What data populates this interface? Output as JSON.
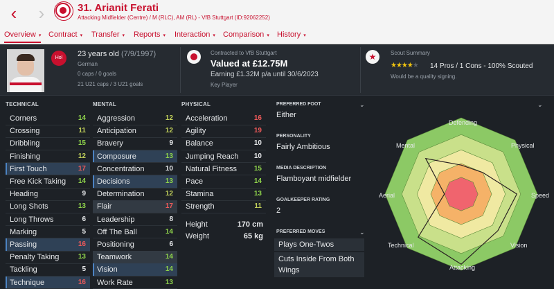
{
  "header": {
    "back_icon": "chevron-left-icon",
    "forward_icon": "chevron-right-icon",
    "player_name": "31. Arianit Ferati",
    "player_subtitle": "Attacking Midfielder (Centre) / M (RLC), AM (RL) - VfB Stuttgart (ID:92062252)"
  },
  "tabs": [
    {
      "label": "Overview",
      "active": true
    },
    {
      "label": "Contract"
    },
    {
      "label": "Transfer"
    },
    {
      "label": "Reports"
    },
    {
      "label": "Interaction"
    },
    {
      "label": "Comparison"
    },
    {
      "label": "History"
    }
  ],
  "overview": {
    "age": "23 years old",
    "dob": "(7/9/1997)",
    "nationality": "German",
    "flag_text": "Hol",
    "caps": "0 caps / 0 goals",
    "u21_caps": "21 U21 caps / 3 U21 goals",
    "contracted_to": "Contracted to VfB Stuttgart",
    "valued": "Valued at £12.75M",
    "earning": "Earning £1.32M p/a until 30/6/2023",
    "squad_status": "Key Player",
    "scout_title": "Scout Summary",
    "scout_stars": 4,
    "scout_pros": "14 Pros / 1 Cons - 100% Scouted",
    "scout_quote": "Would be a quality signing."
  },
  "attributes": {
    "technical_title": "TECHNICAL",
    "mental_title": "MENTAL",
    "physical_title": "PHYSICAL",
    "technical": [
      {
        "name": "Corners",
        "value": "14"
      },
      {
        "name": "Crossing",
        "value": "11"
      },
      {
        "name": "Dribbling",
        "value": "15"
      },
      {
        "name": "Finishing",
        "value": "12"
      },
      {
        "name": "First Touch",
        "value": "17"
      },
      {
        "name": "Free Kick Taking",
        "value": "14"
      },
      {
        "name": "Heading",
        "value": "9"
      },
      {
        "name": "Long Shots",
        "value": "13"
      },
      {
        "name": "Long Throws",
        "value": "6"
      },
      {
        "name": "Marking",
        "value": "5"
      },
      {
        "name": "Passing",
        "value": "16"
      },
      {
        "name": "Penalty Taking",
        "value": "13"
      },
      {
        "name": "Tackling",
        "value": "5"
      },
      {
        "name": "Technique",
        "value": "16"
      }
    ],
    "mental": [
      {
        "name": "Aggression",
        "value": "12"
      },
      {
        "name": "Anticipation",
        "value": "12"
      },
      {
        "name": "Bravery",
        "value": "9"
      },
      {
        "name": "Composure",
        "value": "13"
      },
      {
        "name": "Concentration",
        "value": "10"
      },
      {
        "name": "Decisions",
        "value": "13"
      },
      {
        "name": "Determination",
        "value": "12"
      },
      {
        "name": "Flair",
        "value": "17"
      },
      {
        "name": "Leadership",
        "value": "8"
      },
      {
        "name": "Off The Ball",
        "value": "14"
      },
      {
        "name": "Positioning",
        "value": "6"
      },
      {
        "name": "Teamwork",
        "value": "14"
      },
      {
        "name": "Vision",
        "value": "14"
      },
      {
        "name": "Work Rate",
        "value": "13"
      }
    ],
    "physical": [
      {
        "name": "Acceleration",
        "value": "16"
      },
      {
        "name": "Agility",
        "value": "19"
      },
      {
        "name": "Balance",
        "value": "10"
      },
      {
        "name": "Jumping Reach",
        "value": "10"
      },
      {
        "name": "Natural Fitness",
        "value": "15"
      },
      {
        "name": "Pace",
        "value": "14"
      },
      {
        "name": "Stamina",
        "value": "13"
      },
      {
        "name": "Strength",
        "value": "11"
      }
    ],
    "height_label": "Height",
    "height_value": "170 cm",
    "weight_label": "Weight",
    "weight_value": "65 kg"
  },
  "info": {
    "preferred_foot_label": "PREFERRED FOOT",
    "preferred_foot": "Either",
    "personality_label": "PERSONALITY",
    "personality": "Fairly Ambitious",
    "media_label": "MEDIA DESCRIPTION",
    "media": "Flamboyant midfielder",
    "gk_label": "GOALKEEPER RATING",
    "gk": "2",
    "moves_label": "PREFERRED MOVES",
    "moves": [
      "Plays One-Twos",
      "Cuts Inside From Both",
      "Wings"
    ]
  },
  "radar": {
    "labels": [
      "Defending",
      "Physical",
      "Speed",
      "Vision",
      "Attacking",
      "Technical",
      "Aerial",
      "Mental"
    ],
    "values": [
      0.38,
      0.4,
      0.73,
      0.68,
      0.92,
      0.8,
      0.22,
      0.66
    ]
  },
  "colors": {
    "accent": "#c8102e",
    "high": "#f05a5a",
    "good": "#8fd44b",
    "mid": "#c2d15a",
    "neutral": "#e6e8ea",
    "highlight": "#2f4156"
  }
}
